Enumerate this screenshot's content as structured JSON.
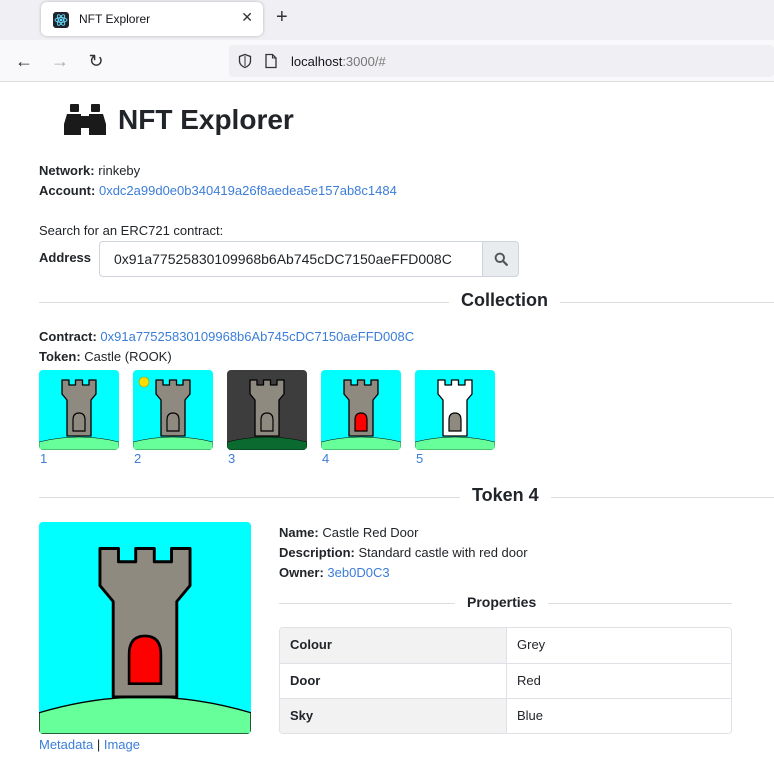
{
  "browser": {
    "tab_title": "NFT Explorer",
    "url_host": "localhost",
    "url_rest": ":3000/#"
  },
  "header": {
    "title": "NFT Explorer"
  },
  "network": {
    "label": "Network:",
    "value": "rinkeby"
  },
  "account": {
    "label": "Account:",
    "value": "0xdc2a99d0e0b340419a26f8aedea5e157ab8c1484"
  },
  "search": {
    "prompt": "Search for an ERC721 contract:",
    "address_label": "Address",
    "address_value": "0x91a77525830109968b6Ab745cDC7150aeFFD008C"
  },
  "collection": {
    "heading": "Collection",
    "contract_label": "Contract:",
    "contract_value": "0x91a77525830109968b6Ab745cDC7150aeFFD008C",
    "token_label": "Token:",
    "token_value": "Castle (ROOK)",
    "tokens": [
      {
        "id": "1",
        "sky": "#00ffff",
        "tower": "#8f8a80",
        "door": "#8f8a80",
        "grass": "#66ff99",
        "sun": false
      },
      {
        "id": "2",
        "sky": "#00ffff",
        "tower": "#8f8a80",
        "door": "#8f8a80",
        "grass": "#66ff99",
        "sun": true
      },
      {
        "id": "3",
        "sky": "#3d3d3d",
        "tower": "#8f8a80",
        "door": "#8f8a80",
        "grass": "#0a6a2f",
        "sun": false
      },
      {
        "id": "4",
        "sky": "#00ffff",
        "tower": "#8f8a80",
        "door": "#ff0000",
        "grass": "#66ff99",
        "sun": false
      },
      {
        "id": "5",
        "sky": "#00ffff",
        "tower": "#ffffff",
        "door": "#8f8a80",
        "grass": "#66ff99",
        "sun": false
      }
    ]
  },
  "token": {
    "heading": "Token 4",
    "name_label": "Name:",
    "name_value": "Castle Red Door",
    "description_label": "Description:",
    "description_value": "Standard castle with red door",
    "owner_label": "Owner:",
    "owner_value": "3eb0D0C3",
    "metadata_link": "Metadata",
    "separator": "|",
    "image_link": "Image",
    "properties_heading": "Properties",
    "properties": [
      {
        "key": "Colour",
        "value": "Grey"
      },
      {
        "key": "Door",
        "value": "Red"
      },
      {
        "key": "Sky",
        "value": "Blue"
      }
    ]
  },
  "colors": {
    "link": "#3b7dd8",
    "sky": "#00ffff",
    "tower": "#8f8a80",
    "door_red": "#ff0000",
    "grass": "#66ff99"
  }
}
